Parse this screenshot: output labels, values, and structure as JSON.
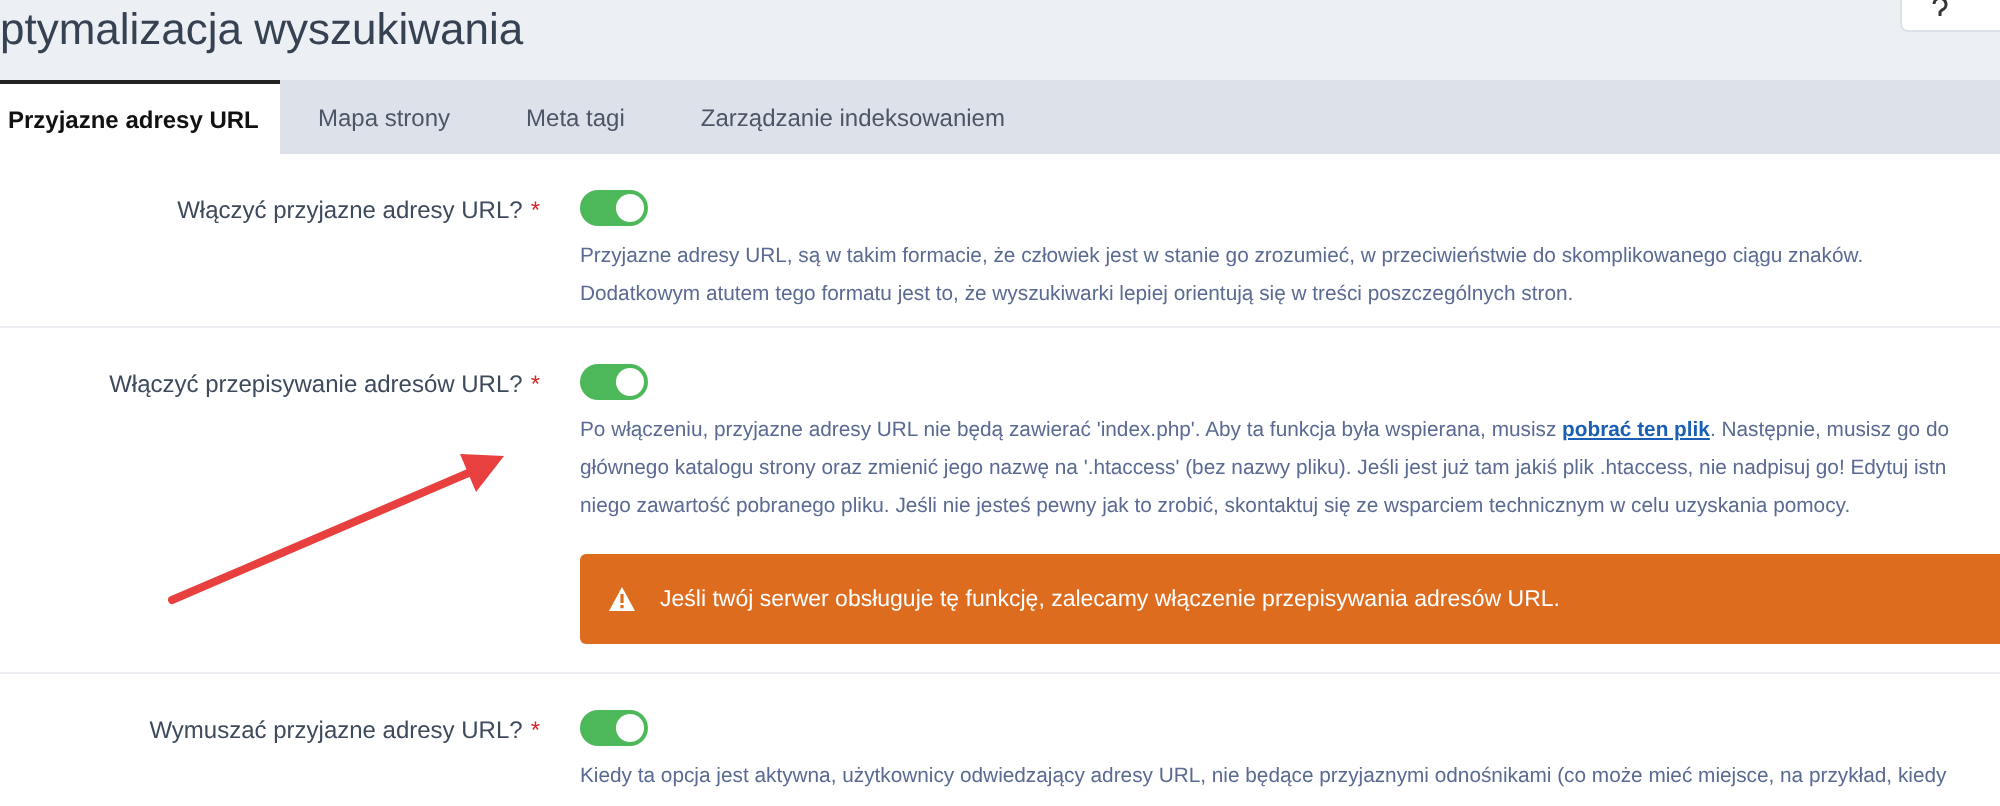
{
  "page_title": "ptymalizacja wyszukiwania",
  "tabs": [
    {
      "label": "Przyjazne adresy URL",
      "selected": true
    },
    {
      "label": "Mapa strony",
      "selected": false
    },
    {
      "label": "Meta tagi",
      "selected": false
    },
    {
      "label": "Zarządzanie indeksowaniem",
      "selected": false
    }
  ],
  "settings": [
    {
      "label": "Włączyć przyjazne adresy URL?",
      "required_mark": "*",
      "on": true,
      "description": [
        [
          {
            "text": "Przyjazne adresy URL, są w takim formacie, że człowiek jest w stanie go zrozumieć, w przeciwieństwie do skomplikowanego ciągu znaków."
          }
        ],
        [
          {
            "text": "Dodatkowym atutem tego formatu jest to, że wyszukiwarki lepiej orientują się w treści poszczególnych stron."
          }
        ]
      ]
    },
    {
      "label": "Włączyć przepisywanie adresów URL?",
      "required_mark": "*",
      "on": true,
      "description": [
        [
          {
            "text": "Po włączeniu, przyjazne adresy URL nie będą zawierać 'index.php'. Aby ta funkcja była wspierana, musisz "
          },
          {
            "text": "pobrać ten plik",
            "kind": "link"
          },
          {
            "text": ". Następnie, musisz go do"
          }
        ],
        [
          {
            "text": "głównego katalogu strony oraz zmienić jego nazwę na '.htaccess' (bez nazwy pliku). Jeśli jest już tam jakiś plik .htaccess, nie nadpisuj go! Edytuj istn"
          }
        ],
        [
          {
            "text": "niego zawartość pobranego pliku. Jeśli nie jesteś pewny jak to zrobić, skontaktuj się ze wsparciem technicznym w celu uzyskania pomocy."
          }
        ]
      ],
      "alert": "Jeśli twój serwer obsługuje tę funkcję, zalecamy włączenie przepisywania adresów URL."
    },
    {
      "label": "Wymuszać przyjazne adresy URL?",
      "required_mark": "*",
      "on": true,
      "description": [
        [
          {
            "text": "Kiedy ta opcja jest aktywna, użytkownicy odwiedzający adresy URL, nie będące przyjaznymi odnośnikami (co może mieć miejsce, na przykład, kiedy"
          }
        ]
      ]
    }
  ]
}
